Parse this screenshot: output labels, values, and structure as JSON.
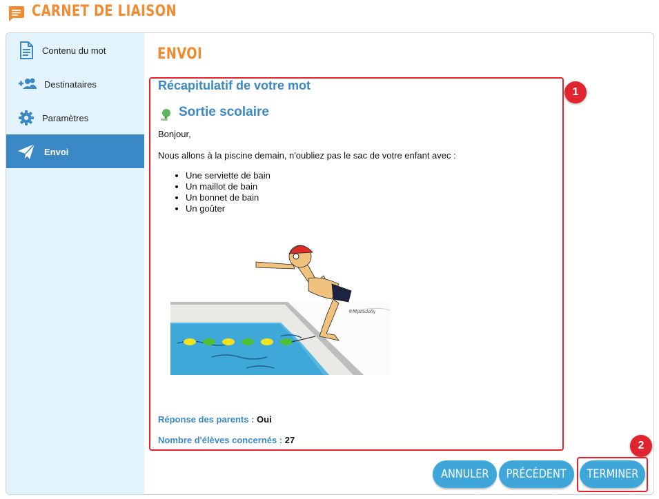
{
  "header": {
    "title": "CARNET DE LIAISON",
    "icon": "message-icon"
  },
  "colors": {
    "orange": "#f28a2f",
    "blue": "#3a88c5",
    "light_blue": "#e3f3fc",
    "button": "#3fa6d9",
    "red": "#e8202a"
  },
  "sidebar": {
    "items": [
      {
        "label": "Contenu du mot",
        "icon": "document-icon",
        "active": false
      },
      {
        "label": "Destinataires",
        "icon": "add-group-icon",
        "active": false
      },
      {
        "label": "Paramètres",
        "icon": "gear-icon",
        "active": false
      },
      {
        "label": "Envoi",
        "icon": "send-icon",
        "active": true
      }
    ]
  },
  "main": {
    "section_title": "ENVOI",
    "recap_title": "Récapitulatif de votre mot",
    "mot": {
      "title": "Sortie scolaire",
      "greeting": "Bonjour,",
      "body": "Nous allons à la piscine demain, n'oubliez pas le sac de votre enfant avec :",
      "items": [
        "Une serviette de bain",
        "Un maillot de bain",
        "Un bonnet de bain",
        "Un goûter"
      ],
      "image_signature": "©Mysticlolly"
    },
    "reponse_label": "Réponse des parents : ",
    "reponse_value": "Oui",
    "eleves_label": "Nombre d'élèves concernés : ",
    "eleves_value": "27"
  },
  "annotations": {
    "badge_1": "1",
    "badge_2": "2"
  },
  "buttons": {
    "annuler": "ANNULER",
    "precedent": "PRÉCÉDENT",
    "terminer": "TERMINER"
  }
}
